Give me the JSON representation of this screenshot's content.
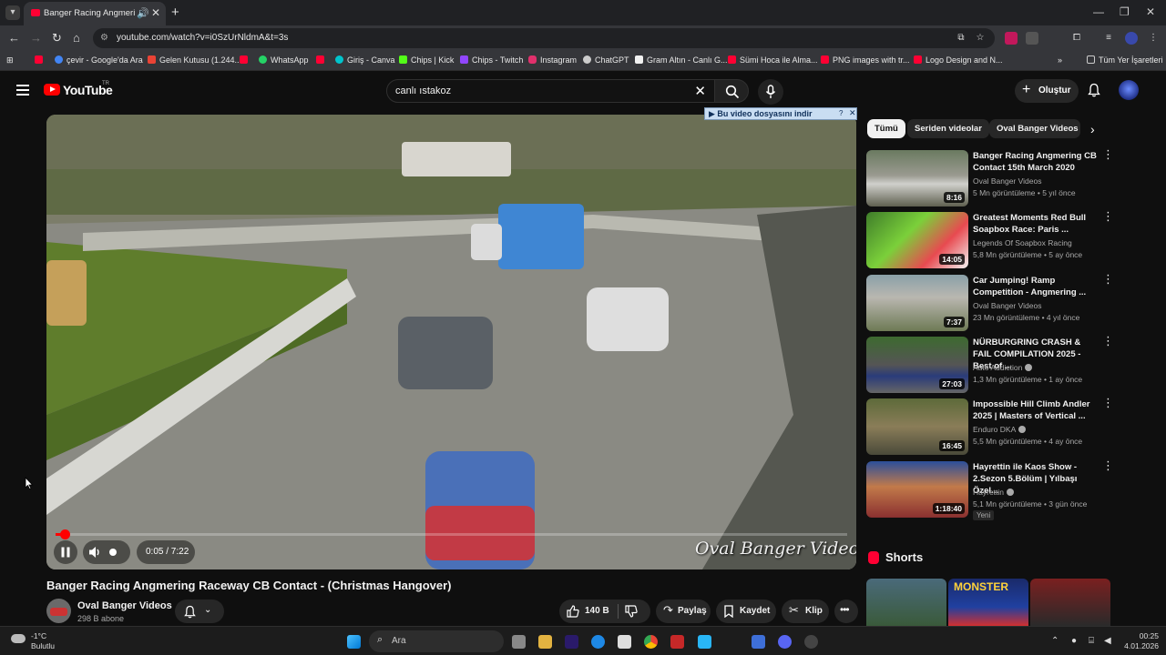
{
  "browser": {
    "tab_title": "Banger Racing Angmering",
    "url": "youtube.com/watch?v=i0SzUrNldmA&t=3s",
    "bookmarks": [
      {
        "label": "çevir - Google'da Ara",
        "color": "#4285f4"
      },
      {
        "label": "Gelen Kutusu (1.244...",
        "color": "#ea4335"
      },
      {
        "label": "WhatsApp",
        "color": "#25d366"
      },
      {
        "label": "Giriş - Canva",
        "color": "#00c4cc"
      },
      {
        "label": "Chips | Kick",
        "color": "#53fc18"
      },
      {
        "label": "Chips - Twitch",
        "color": "#9146ff"
      },
      {
        "label": "Instagram",
        "color": "#e1306c"
      },
      {
        "label": "ChatGPT",
        "color": "#cccccc"
      },
      {
        "label": "Gram Altın - Canlı G...",
        "color": "#f1f1f1"
      },
      {
        "label": "Sümi Hoca ile Alma...",
        "color": "#ff0000"
      },
      {
        "label": "PNG images with tr...",
        "color": "#ff0000"
      },
      {
        "label": "Logo Design and N...",
        "color": "#ff0000"
      }
    ],
    "all_bookmarks": "Tüm Yer İşaretleri"
  },
  "youtube": {
    "logo": "YouTube",
    "country": "TR",
    "search_value": "canlı ıstakoz",
    "create_label": "Oluştur"
  },
  "player": {
    "download_bar": "Bu video dosyasını indir",
    "download_help": "?",
    "time": "0:05 / 7:22",
    "progress": 0.011,
    "watermark": "Oval Banger Videos"
  },
  "video": {
    "title": "Banger Racing Angmering Raceway CB Contact - (Christmas Hangover)",
    "channel": "Oval Banger Videos",
    "subscribers": "298 B abone",
    "likes": "140 B",
    "share": "Paylaş",
    "save": "Kaydet",
    "clip": "Klip"
  },
  "chips": [
    "Tümü",
    "Seriden videolar",
    "Oval Banger Videos e"
  ],
  "recommendations": [
    {
      "title": "Banger Racing Angmering CB Contact 15th March 2020",
      "channel": "Oval Banger Videos",
      "meta": "5 Mn görüntüleme • 5 yıl önce",
      "duration": "8:16",
      "verified": false,
      "badge": ""
    },
    {
      "title": "Greatest Moments Red Bull Soapbox Race: Paris ...",
      "channel": "Legends Of Soapbox Racing",
      "meta": "5,8 Mn görüntüleme • 5 ay önce",
      "duration": "14:05",
      "verified": false,
      "badge": ""
    },
    {
      "title": "Car Jumping! Ramp Competition - Angmering ...",
      "channel": "Oval Banger Videos",
      "meta": "23 Mn görüntüleme • 4 yıl önce",
      "duration": "7:37",
      "verified": false,
      "badge": ""
    },
    {
      "title": "NÜRBURGRING CRASH & FAIL COMPILATION 2025 - Best of ...",
      "channel": "Auto Addiction",
      "meta": "1,3 Mn görüntüleme • 1 ay önce",
      "duration": "27:03",
      "verified": true,
      "badge": ""
    },
    {
      "title": "Impossible Hill Climb Andler 2025 | Masters of Vertical ...",
      "channel": "Enduro DKA",
      "meta": "5,5 Mn görüntüleme • 4 ay önce",
      "duration": "16:45",
      "verified": true,
      "badge": ""
    },
    {
      "title": "Hayrettin ile Kaos Show - 2.Sezon 5.Bölüm | Yılbaşı Özel...",
      "channel": "Hayrettin",
      "meta": "5,1 Mn görüntüleme • 3 gün önce",
      "duration": "1:18:40",
      "verified": true,
      "badge": "Yeni"
    }
  ],
  "shorts": {
    "title": "Shorts",
    "items": [
      {
        "text": ""
      },
      {
        "text": "MONSTER"
      },
      {
        "text": ""
      }
    ]
  },
  "taskbar": {
    "weather_temp": "-1°C",
    "weather_desc": "Bulutlu",
    "search": "Ara",
    "time": "00:25",
    "date": "4.01.2026"
  }
}
